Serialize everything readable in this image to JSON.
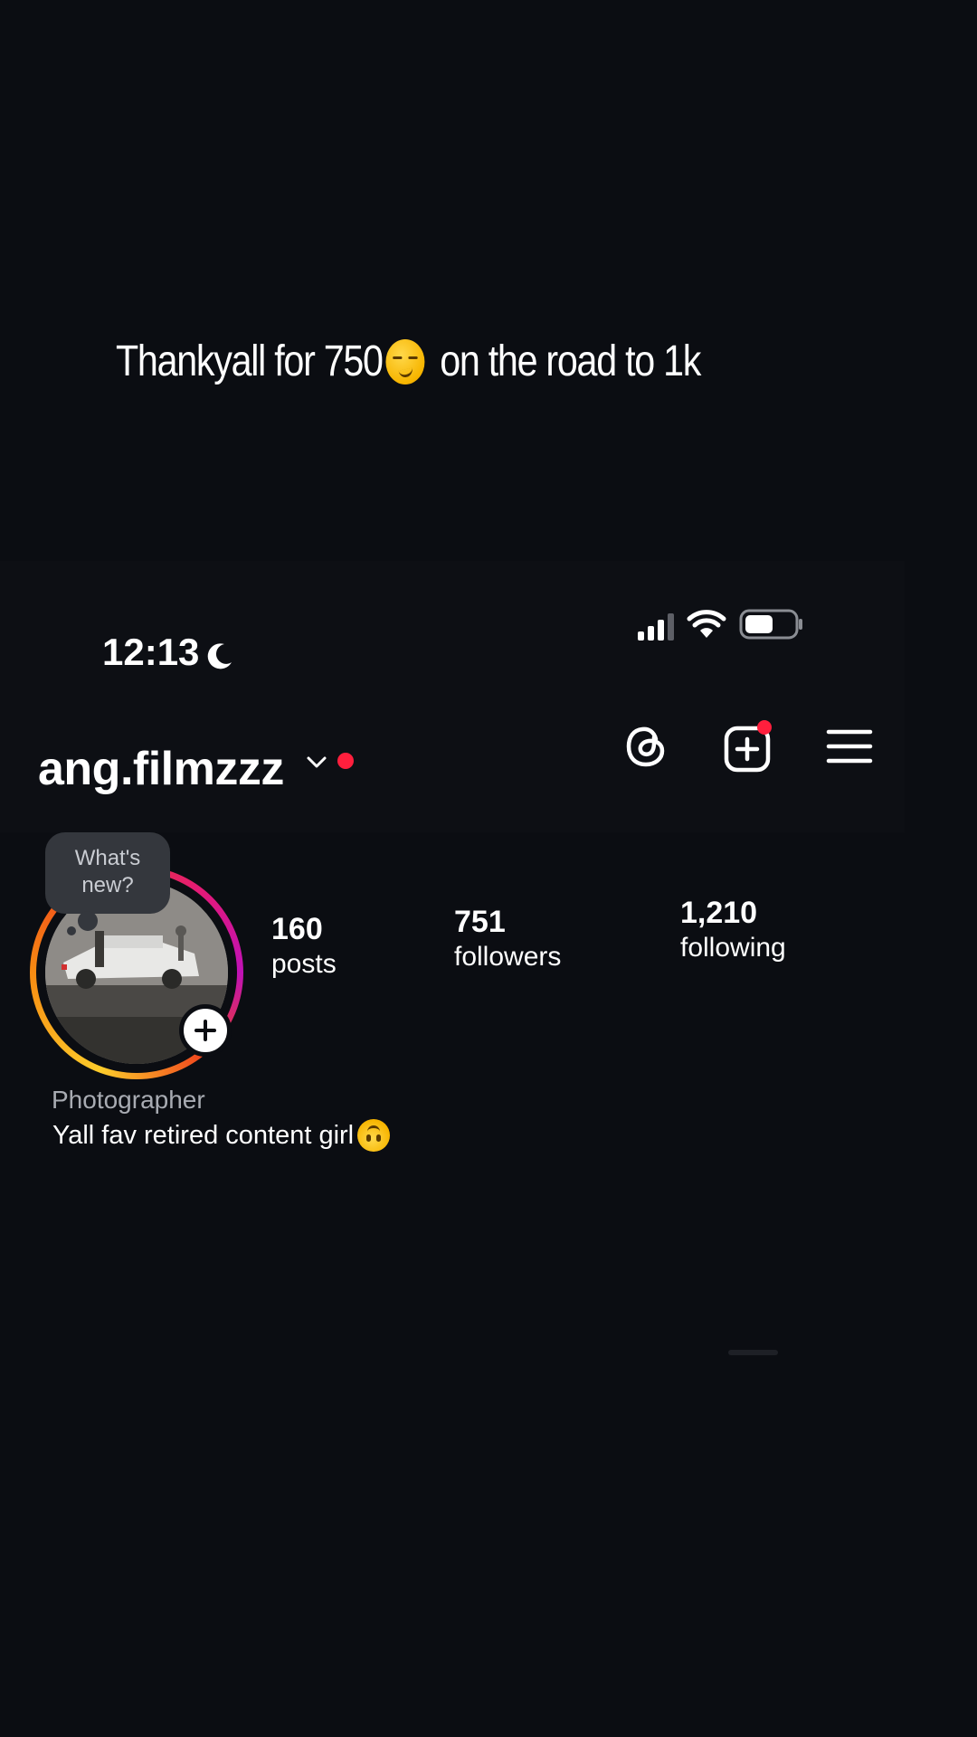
{
  "overlay_caption": {
    "text_before": "Thankyall for 750",
    "emoji": "smirking-face-emoji",
    "text_after": " on the road to 1k"
  },
  "status_bar": {
    "time": "12:13",
    "focus_icon": "moon-icon",
    "signal_icon": "cellular-signal-icon",
    "wifi_icon": "wifi-icon",
    "battery_icon": "battery-icon"
  },
  "profile_header": {
    "username": "ang.filmzzz",
    "dropdown_icon": "chevron-down-icon",
    "icons": [
      "threads-icon",
      "create-post-icon",
      "menu-icon"
    ],
    "accent_color": "#ff1f3d"
  },
  "note": {
    "text": "What's new?"
  },
  "stats": {
    "posts": {
      "value": "160",
      "label": "posts"
    },
    "followers": {
      "value": "751",
      "label": "followers"
    },
    "following": {
      "value": "1,210",
      "label": "following"
    }
  },
  "bio": {
    "category": "Photographer",
    "text": "Yall fav retired content girl",
    "emoji": "upside-down-face-emoji"
  },
  "colors": {
    "background": "#0b0d12",
    "text_primary": "#ffffff",
    "text_secondary": "#a8abb2",
    "note_bubble": "#34373d",
    "story_ring": [
      "#fdcc2b",
      "#f78b12",
      "#e3197a",
      "#c012b6"
    ]
  }
}
